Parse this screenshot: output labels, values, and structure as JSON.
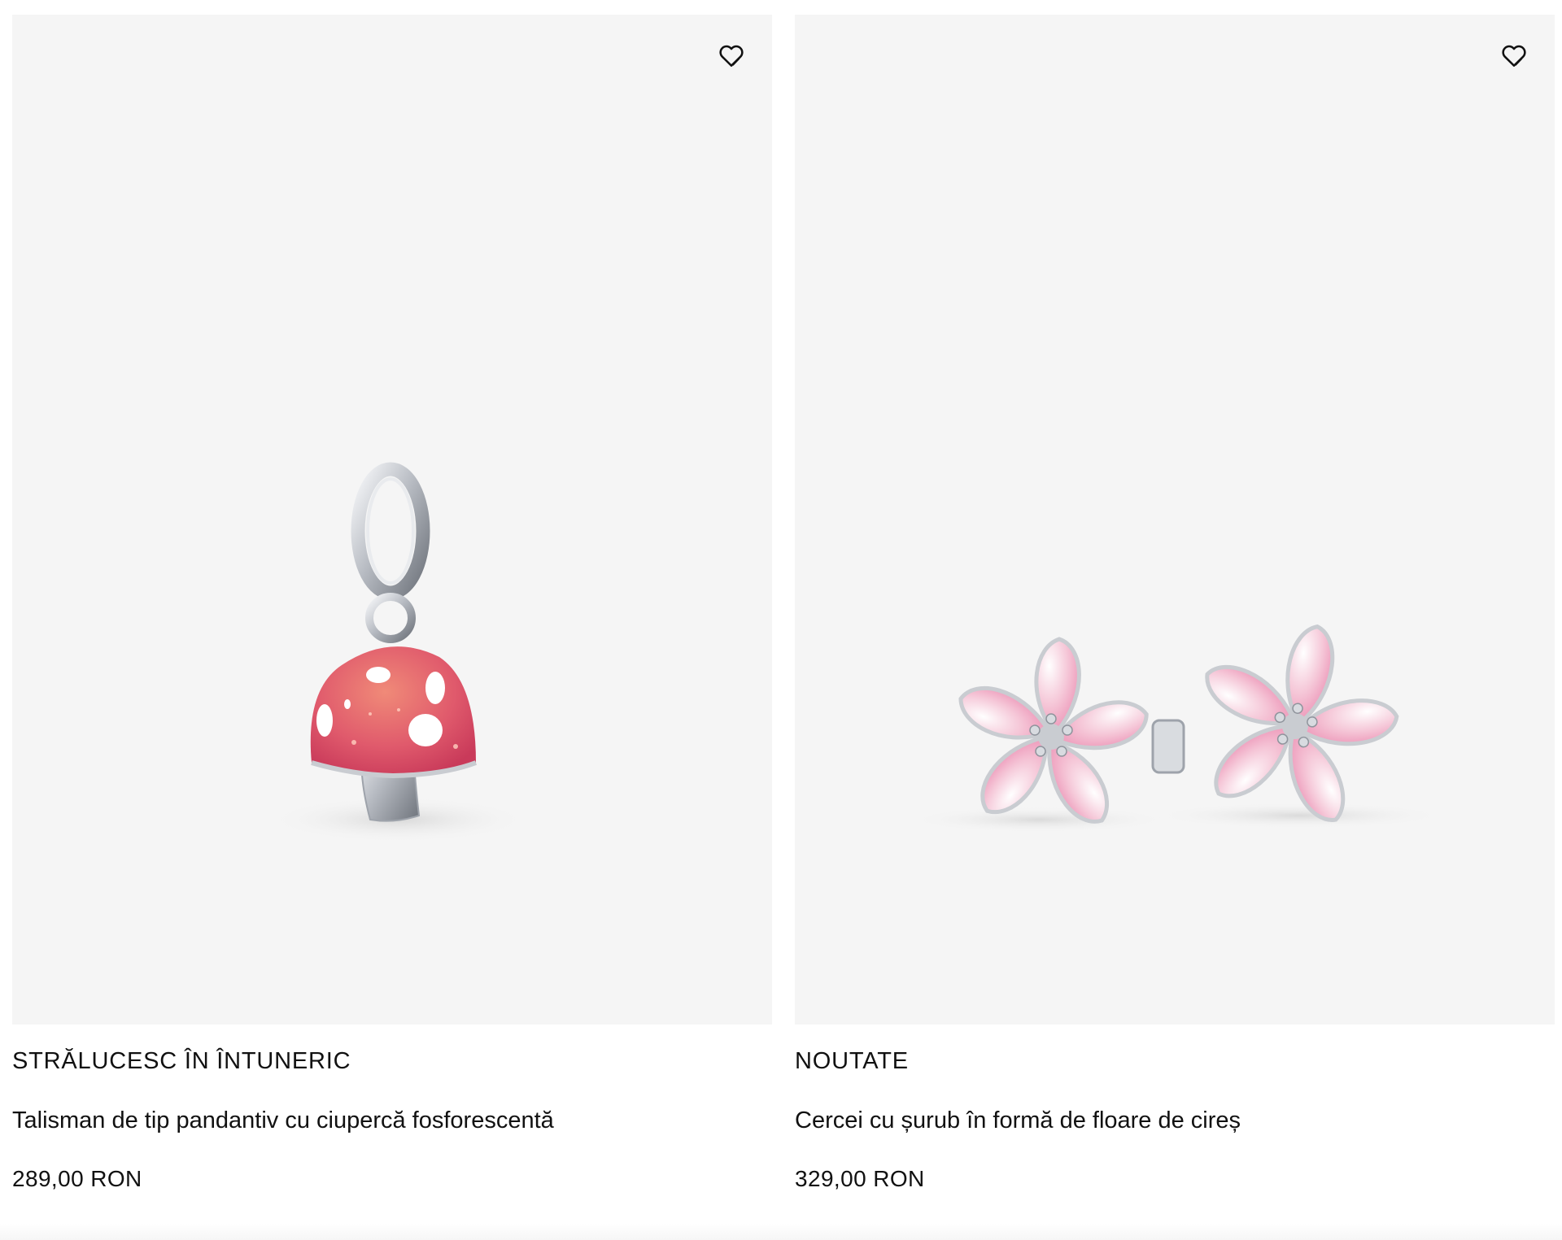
{
  "products": [
    {
      "badge": "STRĂLUCESC ÎN ÎNTUNERIC",
      "title": "Talisman de tip pandantiv cu ciupercă fosforescentă",
      "price": "289,00 RON",
      "image_icon": "mushroom-dangle-charm-icon",
      "wishlist_icon": "heart-outline-icon"
    },
    {
      "badge": "NOUTATE",
      "title": "Cercei cu șurub în formă de floare de cireș",
      "price": "329,00 RON",
      "image_icon": "cherry-blossom-earrings-icon",
      "wishlist_icon": "heart-outline-icon"
    }
  ],
  "colors": {
    "image_background": "#f5f5f5",
    "text": "#111111",
    "mushroom_cap": "#e8556a",
    "blossom_pink": "#f2a9c4",
    "silver": "#c9ccd1"
  }
}
